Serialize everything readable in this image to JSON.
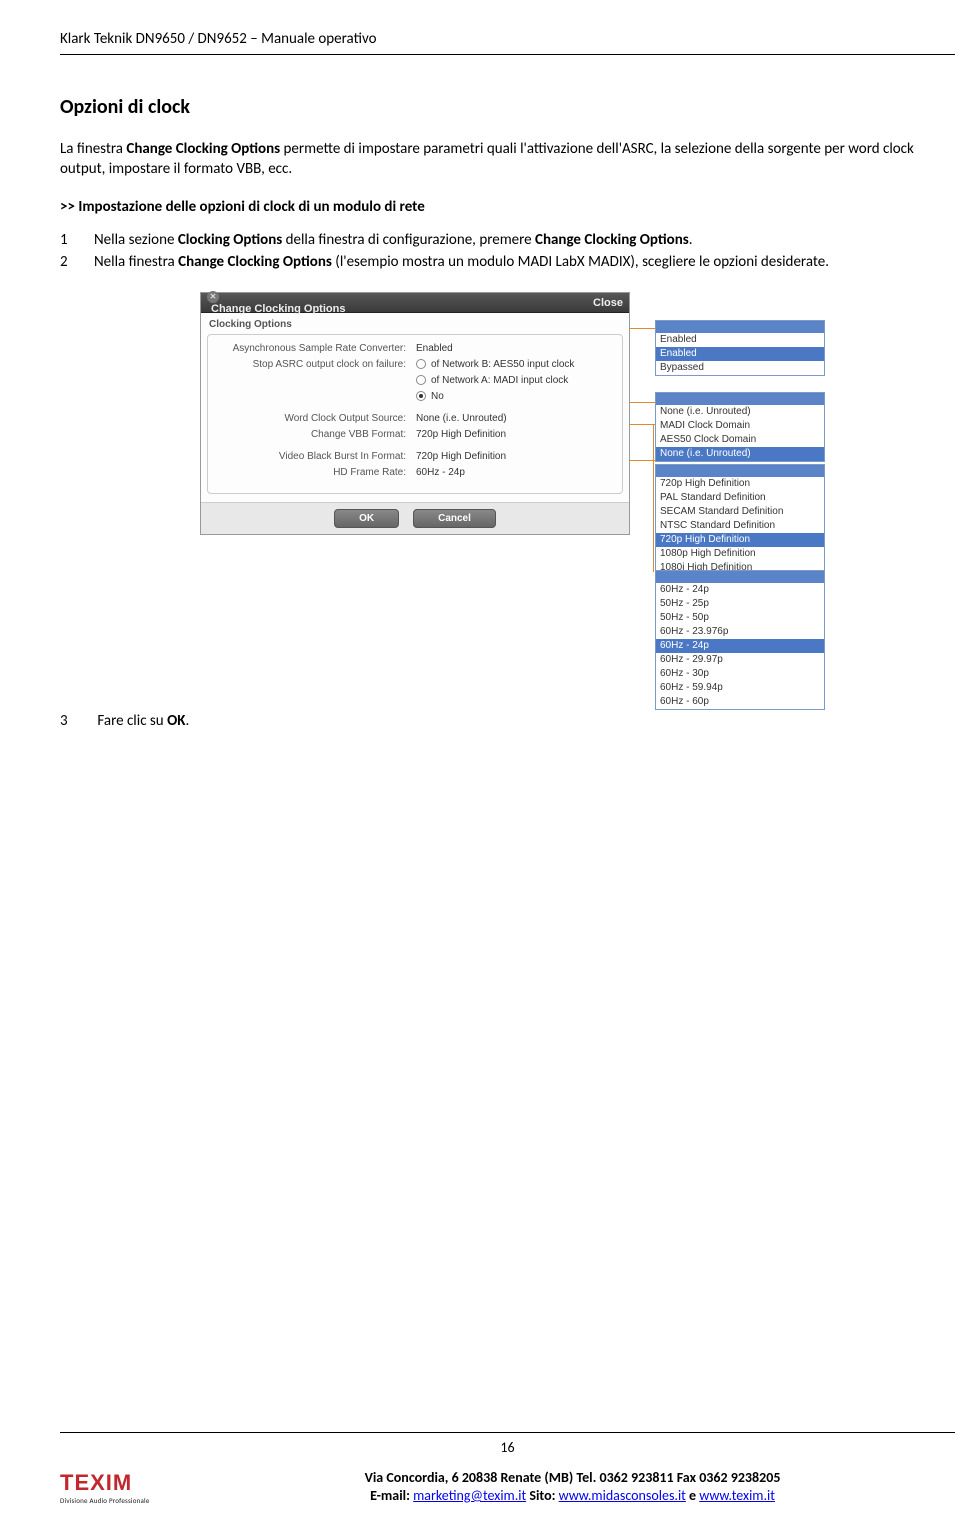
{
  "doc_header": "Klark Teknik DN9650 / DN9652 – Manuale operativo",
  "h2": "Opzioni di clock",
  "para1_a": "La finestra ",
  "para1_b": "Change Clocking Options",
  "para1_c": " permette di impostare parametri quali l'attivazione dell'ASRC, la selezione della sorgente per word clock output, impostare il formato VBB, ecc.",
  "sub": ">> Impostazione delle opzioni di clock di un modulo di rete",
  "step1_a": "Nella sezione ",
  "step1_b": "Clocking Options",
  "step1_c": " della finestra di configurazione, premere ",
  "step1_d": "Change Clocking Options",
  "step1_e": ".",
  "step2_a": "Nella finestra ",
  "step2_b": "Change Clocking Options",
  "step2_c": " (l'esempio mostra un modulo MADI LabX MADIX), scegliere le opzioni desiderate.",
  "step3_a": "Fare clic su ",
  "step3_b": "OK",
  "step3_c": ".",
  "dialog": {
    "title": "Change Clocking Options",
    "close": "Close",
    "section": "Clocking Options",
    "rows": {
      "asrc_label": "Asynchronous Sample Rate Converter:",
      "asrc_value": "Enabled",
      "stop_label": "Stop ASRC output clock on failure:",
      "stop_opt1": "of Network B: AES50 input clock",
      "stop_opt2": "of Network A: MADI input clock",
      "stop_opt3": "No",
      "wcos_label": "Word Clock Output Source:",
      "wcos_value": "None (i.e. Unrouted)",
      "vbb_label": "Change VBB Format:",
      "vbb_value": "720p High Definition",
      "vbbi_label": "Video Black Burst In Format:",
      "vbbi_value": "720p High Definition",
      "hd_label": "HD Frame Rate:",
      "hd_value": "60Hz - 24p"
    },
    "ok": "OK",
    "cancel": "Cancel"
  },
  "dd1": {
    "opts": [
      "Enabled",
      "Enabled",
      "Bypassed"
    ],
    "sel": 1
  },
  "dd2": {
    "opts": [
      "None (i.e. Unrouted)",
      "MADI Clock Domain",
      "AES50 Clock Domain",
      "None (i.e. Unrouted)"
    ],
    "sel": 3
  },
  "dd3": {
    "opts": [
      "720p High Definition",
      "PAL Standard Definition",
      "SECAM Standard Definition",
      "NTSC Standard Definition",
      "720p High Definition",
      "1080p High Definition",
      "1080i High Definition"
    ],
    "sel": 4
  },
  "dd4": {
    "opts": [
      "60Hz - 24p",
      "50Hz - 25p",
      "50Hz - 50p",
      "60Hz - 23.976p",
      "60Hz - 24p",
      "60Hz - 29.97p",
      "60Hz - 30p",
      "60Hz - 59.94p",
      "60Hz - 60p"
    ],
    "sel": 4
  },
  "page_number": "16",
  "logo_main": "TEXIM",
  "logo_sub": "Divisione Audio Professionale",
  "footer_addr": "Via Concordia, 6 20838 Renate (MB) Tel. 0362 923811 Fax 0362 9238205",
  "footer_email_label": "E-mail: ",
  "footer_email": "marketing@texim.it",
  "footer_sito_label": "   Sito: ",
  "footer_link1": "www.midasconsoles.it",
  "footer_e": " e ",
  "footer_link2": "www.texim.it"
}
